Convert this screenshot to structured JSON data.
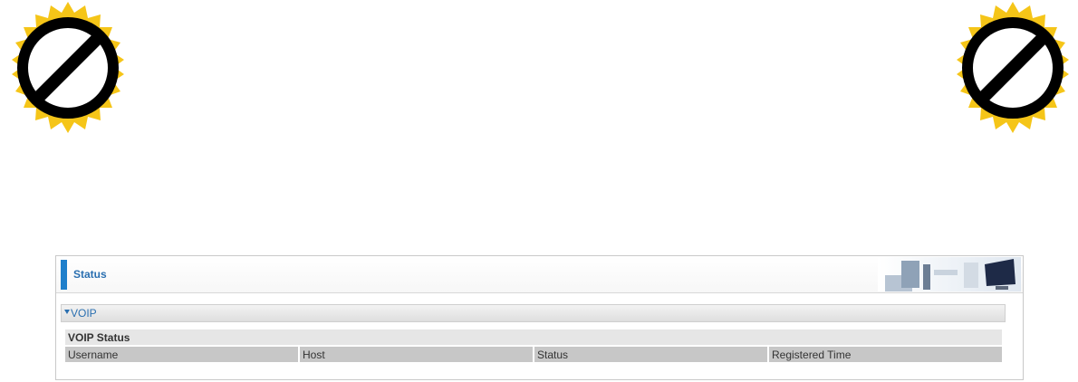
{
  "panel": {
    "title": "Status"
  },
  "section": {
    "label": "VOIP"
  },
  "table": {
    "caption": "VOIP Status",
    "headers": [
      "Username",
      "Host",
      "Status",
      "Registered Time"
    ]
  },
  "colors": {
    "accent": "#1f7fcb",
    "badge_gold": "#f5c518"
  },
  "icons": [
    "no-entry-badge-icon",
    "office-banner-image",
    "triangle-down-icon"
  ]
}
